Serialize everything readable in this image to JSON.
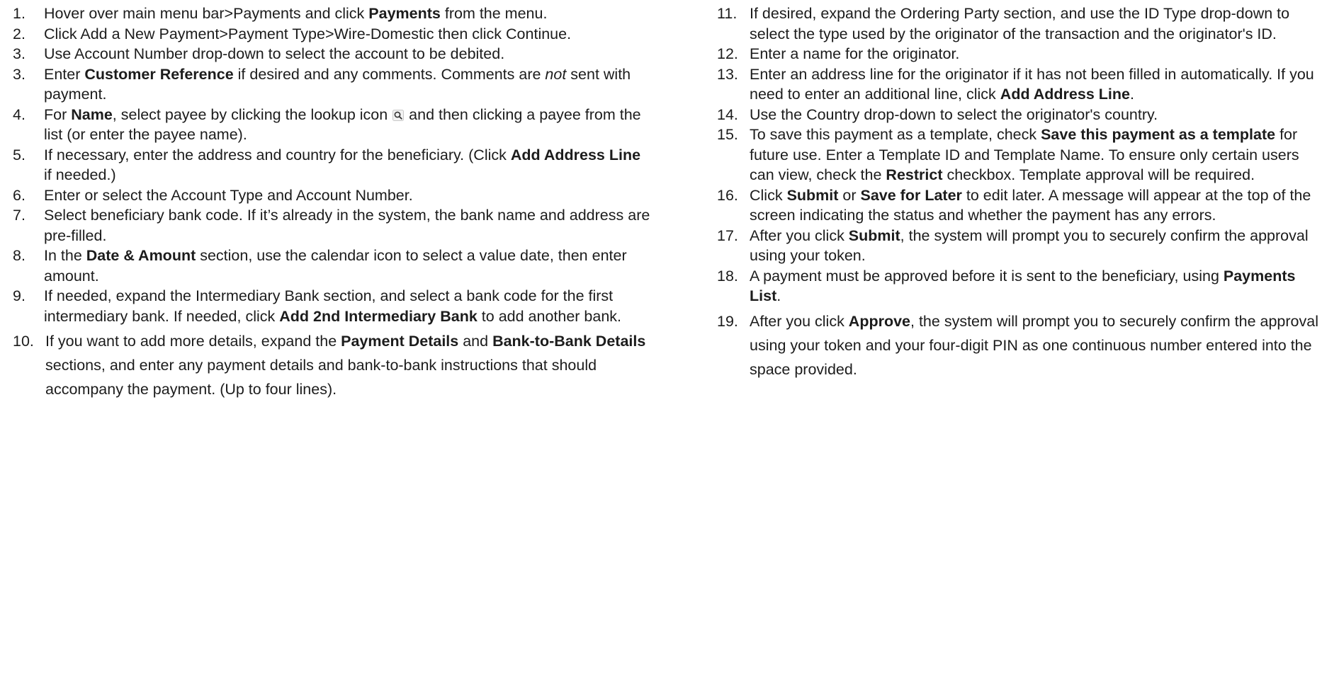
{
  "left_column": {
    "steps": [
      {
        "number": "1.",
        "parts": [
          {
            "t": "Hover over main menu bar>Payments and click "
          },
          {
            "t": "Payments",
            "s": "b"
          },
          {
            "t": " from the menu."
          }
        ]
      },
      {
        "number": "2.",
        "parts": [
          {
            "t": "Click Add a New Payment>Payment Type>Wire-Domestic then click Continue."
          }
        ]
      },
      {
        "number": "3.",
        "parts": [
          {
            "t": "Use Account Number drop-down to select the account to be debited."
          }
        ]
      },
      {
        "number": "3.",
        "parts": [
          {
            "t": "Enter "
          },
          {
            "t": "Customer Reference",
            "s": "b"
          },
          {
            "t": " if desired and any comments. Comments are "
          },
          {
            "t": "not",
            "s": "i"
          },
          {
            "t": " sent with payment."
          }
        ]
      },
      {
        "number": "4.",
        "parts": [
          {
            "t": "For "
          },
          {
            "t": "Name",
            "s": "b"
          },
          {
            "t": ", select payee by clicking the lookup icon "
          },
          {
            "icon": "magnifier-lookup-icon"
          },
          {
            "t": " and then clicking a payee from the list (or enter the payee name)."
          }
        ]
      },
      {
        "number": "5.",
        "parts": [
          {
            "t": "If necessary, enter the address and country for the beneficiary. (Click "
          },
          {
            "t": "Add Address Line",
            "s": "b"
          },
          {
            "t": " if needed.)"
          }
        ]
      },
      {
        "number": "6.",
        "parts": [
          {
            "t": "Enter or select the Account Type and Account Number."
          }
        ]
      },
      {
        "number": "7.",
        "parts": [
          {
            "t": "Select beneficiary bank code. If it’s already in the system, the bank name and address are pre-filled."
          }
        ]
      },
      {
        "number": "8.",
        "parts": [
          {
            "t": "In the "
          },
          {
            "t": "Date & Amount",
            "s": "b"
          },
          {
            "t": " section, use the calendar icon to select a value date, then enter amount."
          }
        ]
      },
      {
        "number": "9.",
        "parts": [
          {
            "t": " If needed, expand the Intermediary Bank section, and select a bank code for the first intermediary bank. If needed, click "
          },
          {
            "t": "Add 2nd Intermediary Bank",
            "s": "b"
          },
          {
            "t": " to add another bank."
          }
        ]
      },
      {
        "number": "10.",
        "gap": true,
        "loose": true,
        "parts": [
          {
            "t": "If you want to add more details, expand the "
          },
          {
            "t": "Payment Details",
            "s": "b"
          },
          {
            "t": " and "
          },
          {
            "t": "Bank-to-Bank Details",
            "s": "b"
          },
          {
            "t": " sections, and enter any payment details and bank-to-bank instructions that should accompany the payment. (Up to four lines)."
          }
        ]
      }
    ]
  },
  "right_column": {
    "steps": [
      {
        "number": "11.",
        "parts": [
          {
            "t": "If desired, expand the Ordering Party section, and use the ID Type drop-down to select the type used by the originator of the transaction and the originator's ID."
          }
        ]
      },
      {
        "number": "12.",
        "parts": [
          {
            "t": "Enter a name for the originator."
          }
        ]
      },
      {
        "number": "13.",
        "parts": [
          {
            "t": "Enter an address line for the originator if it has not been filled in automatically. If you need to enter an additional line, click "
          },
          {
            "t": "Add Address Line",
            "s": "b"
          },
          {
            "t": "."
          }
        ]
      },
      {
        "number": "14.",
        "parts": [
          {
            "t": "Use the Country drop-down to select the originator's country."
          }
        ]
      },
      {
        "number": "15.",
        "parts": [
          {
            "t": "To save this payment as a template, check "
          },
          {
            "t": "Save this payment as a template",
            "s": "b"
          },
          {
            "t": " for future use. Enter a Template ID and Template Name. To ensure only certain users can view, check the "
          },
          {
            "t": "Restrict",
            "s": "b"
          },
          {
            "t": " checkbox. Template approval will be required."
          }
        ]
      },
      {
        "number": "16.",
        "parts": [
          {
            "t": "Click "
          },
          {
            "t": "Submit",
            "s": "b"
          },
          {
            "t": " or "
          },
          {
            "t": "Save for Later",
            "s": "b"
          },
          {
            "t": " to edit later. A message will appear at the top of the screen indicating the status and whether the payment has any errors."
          }
        ]
      },
      {
        "number": "17.",
        "parts": [
          {
            "t": "After you click "
          },
          {
            "t": "Submit",
            "s": "b"
          },
          {
            "t": ", the system will prompt you to securely confirm the approval using your token."
          }
        ]
      },
      {
        "number": "18.",
        "parts": [
          {
            "t": "A payment must be approved before it is sent to the beneficiary, using "
          },
          {
            "t": "Payments List",
            "s": "b"
          },
          {
            "t": "."
          }
        ]
      },
      {
        "number": "19.",
        "gap": true,
        "loose": true,
        "parts": [
          {
            "t": "After you click "
          },
          {
            "t": "Approve",
            "s": "b"
          },
          {
            "t": ", the system will prompt you to securely confirm the approval using your token and your four-digit PIN as one continuous number entered into the space provided."
          }
        ]
      }
    ]
  }
}
